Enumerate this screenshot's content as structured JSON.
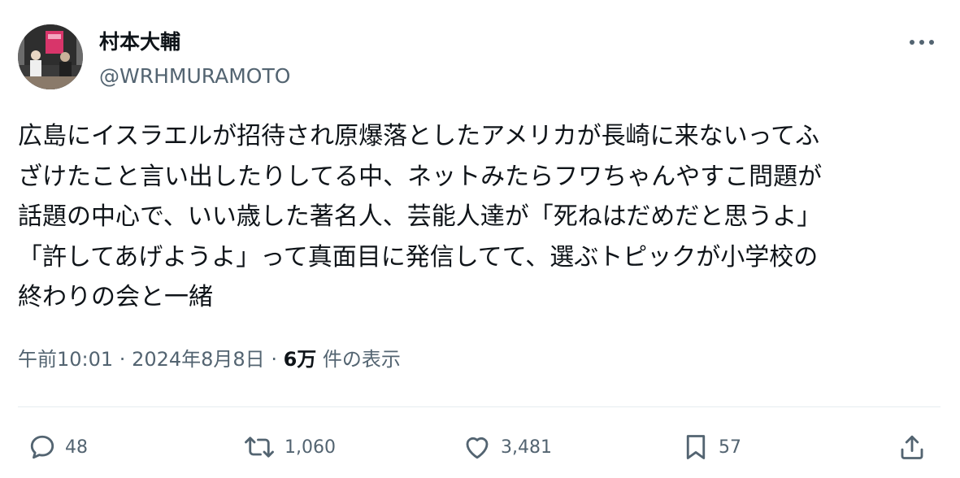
{
  "author": {
    "name": "村本大輔",
    "handle": "@WRHMURAMOTO"
  },
  "tweet": {
    "text": "広島にイスラエルが招待され原爆落としたアメリカが長崎に来ないってふ\nざけたこと言い出したりしてる中、ネットみたらフワちゃんやすこ問題が\n話題の中心で、いい歳した著名人、芸能人達が「死ねはだめだと思うよ」\n「許してあげようよ」って真面目に発信してて、選ぶトピックが小学校の\n終わりの会と一緒"
  },
  "meta": {
    "time": "午前10:01",
    "separator1": " · ",
    "date": "2024年8月8日",
    "separator2": " · ",
    "views_count": "6万",
    "views_label": " 件の表示"
  },
  "actions": {
    "replies": "48",
    "retweets": "1,060",
    "likes": "3,481",
    "bookmarks": "57"
  },
  "icons": {
    "more": "more-dots-icon",
    "reply": "reply-bubble-icon",
    "retweet": "retweet-icon",
    "like": "heart-icon",
    "bookmark": "bookmark-icon",
    "share": "share-icon"
  },
  "colors": {
    "text_primary": "#0f1419",
    "text_secondary": "#536471",
    "divider": "#e6ecf0"
  }
}
